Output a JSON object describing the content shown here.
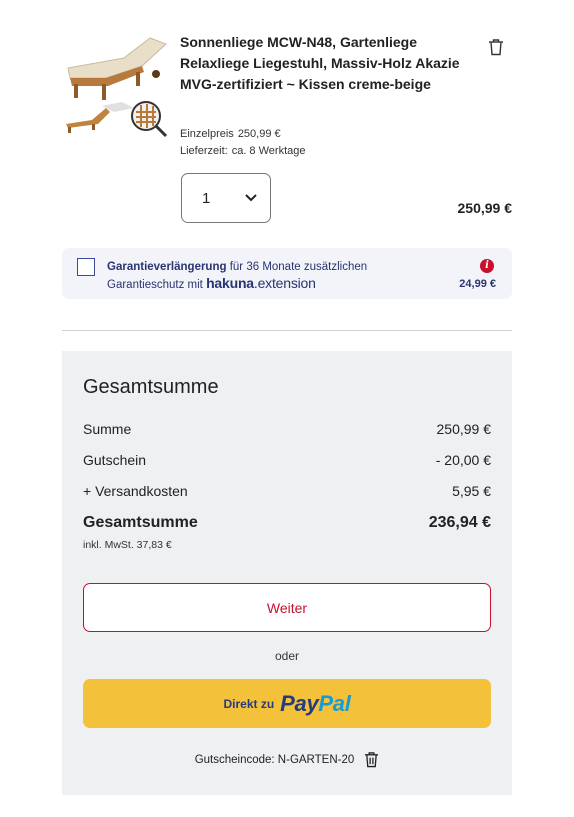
{
  "product": {
    "title": "Sonnenliege MCW-N48, Gartenliege Relaxliege Liegestuhl, Massiv-Holz Akazie MVG-zertifiziert ~ Kissen creme-beige",
    "unit_price_label": "Einzelpreis",
    "unit_price": "250,99 €",
    "delivery_label": "Lieferzeit:",
    "delivery": "ca. 8 Werktage",
    "quantity": "1",
    "line_total": "250,99 €"
  },
  "warranty": {
    "title_bold": "Garantieverlängerung",
    "text_rest": " für 36 Monate zusätzlichen",
    "text_line2": "Garantieschutz mit",
    "brand_main": "hakuna",
    "brand_ext": ".extension",
    "price": "24,99 €",
    "info_glyph": "i"
  },
  "summary": {
    "heading": "Gesamtsumme",
    "rows": [
      {
        "label": "Summe",
        "value": "250,99 €"
      },
      {
        "label": "Gutschein",
        "value": "- 20,00 €"
      },
      {
        "label": "+ Versandkosten",
        "value": "5,95 €"
      }
    ],
    "total_label": "Gesamtsumme",
    "total_value": "236,94 €",
    "vat_note": "inkl. MwSt. 37,83 €",
    "continue_label": "Weiter",
    "or_label": "oder",
    "paypal_prefix": "Direkt zu",
    "paypal_word1": "Pay",
    "paypal_word2": "Pal",
    "coupon_text": "Gutscheincode: N-GARTEN-20"
  },
  "colors": {
    "accent_red": "#c8102e",
    "paypal_yellow": "#f3c13a",
    "navy": "#2a3470"
  },
  "icons": {
    "remove_item": "trash-icon",
    "quantity": "chevron-down-icon",
    "info": "info-icon",
    "remove_coupon": "trash-icon"
  }
}
